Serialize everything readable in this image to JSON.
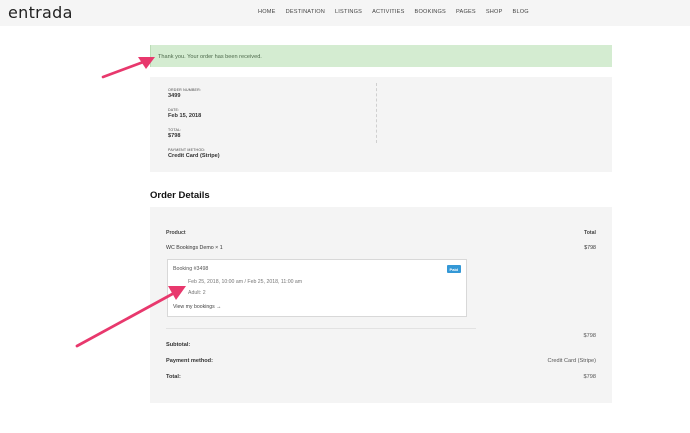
{
  "header": {
    "logo": "entrada",
    "nav": [
      "HOME",
      "DESTINATION",
      "LISTINGS",
      "ACTIVITIES",
      "BOOKINGS",
      "PAGES",
      "SHOP",
      "BLOG"
    ]
  },
  "notice": {
    "text": "Thank you. Your order has been received."
  },
  "overview": {
    "order_number_label": "ORDER NUMBER:",
    "order_number": "3499",
    "date_label": "DATE:",
    "date": "Feb 15, 2018",
    "total_label": "TOTAL:",
    "total": "$798",
    "payment_label": "PAYMENT METHOD:",
    "payment": "Credit Card (Stripe)"
  },
  "order_details": {
    "title": "Order Details",
    "col_product": "Product",
    "col_total": "Total",
    "product_name": "WC Bookings Demo × 1",
    "product_total": "$798",
    "booking": {
      "title": "Booking #3498",
      "status": "Paid",
      "dates": "Feb 25, 2018, 10:00 am / Feb 25, 2018, 11:00 am",
      "persons": "Adult: 2",
      "link": "View my bookings →"
    },
    "subtotal_label": "Subtotal:",
    "subtotal_value": "$798",
    "payment_label": "Payment method:",
    "payment_value": "Credit Card (Stripe)",
    "total_label": "Total:",
    "total_value": "$798"
  },
  "colors": {
    "notice_bg": "#d4ecd1",
    "arrow": "#e8386d",
    "badge": "#3498d6"
  }
}
